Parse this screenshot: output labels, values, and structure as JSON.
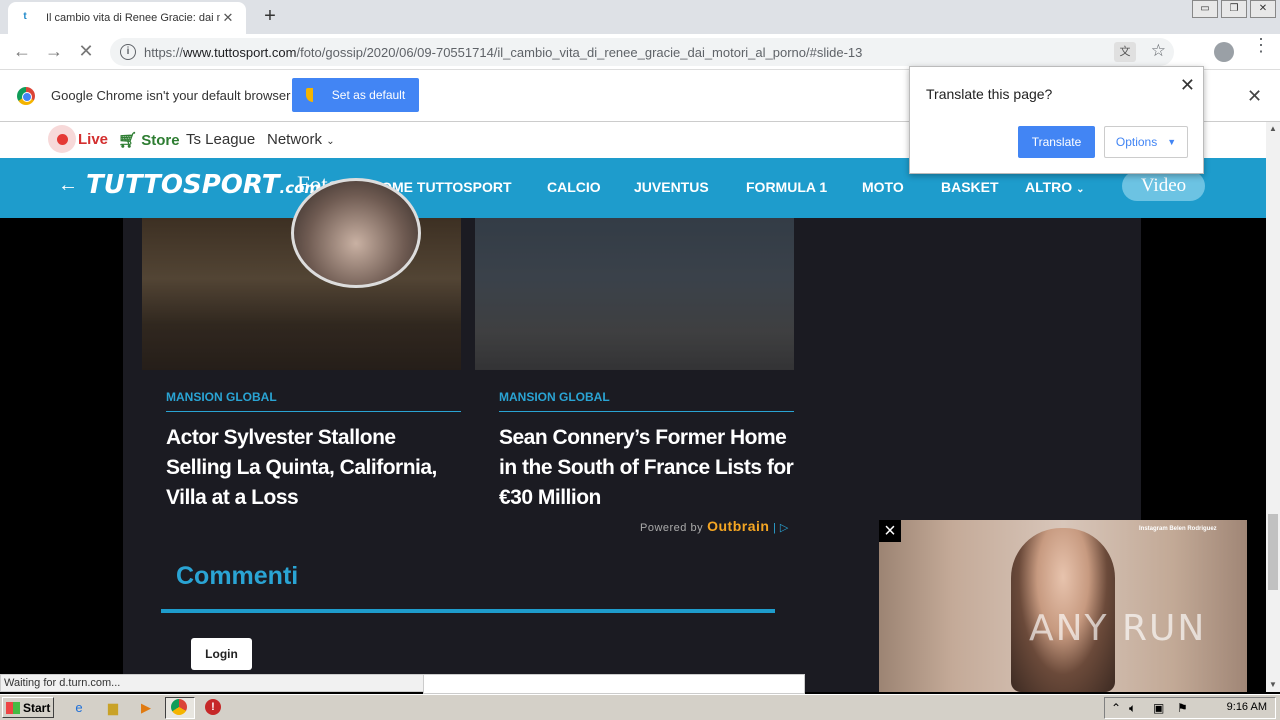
{
  "browser": {
    "tab_title": "Il cambio vita di Renee Gracie: dai m",
    "tab_close": "✕",
    "new_tab": "+",
    "url_prefix": "https://",
    "url_domain": "www.tuttosport.com",
    "url_path": "/foto/gossip/2020/06/09-70551714/il_cambio_vita_di_renee_gracie_dai_motori_al_porno/#slide-13",
    "window_controls": [
      "▭",
      "❐",
      "✕"
    ]
  },
  "infobar": {
    "message": "Google Chrome isn't your default browser",
    "button": "Set as default",
    "close": "✕"
  },
  "translate_popup": {
    "question": "Translate this page?",
    "translate_button": "Translate",
    "options_button": "Options",
    "close": "✕"
  },
  "site_top": {
    "live": "Live",
    "store": "Store",
    "league": "Ts League",
    "network": "Network"
  },
  "site_nav": {
    "brand": "TUTTOSPORT",
    "brand_suffix": ".com",
    "section": "Foto",
    "items": [
      "HOME TUTTOSPORT",
      "CALCIO",
      "JUVENTUS",
      "FORMULA 1",
      "MOTO",
      "BASKET",
      "ALTRO"
    ],
    "video": "Video"
  },
  "cards": [
    {
      "source": "MANSION GLOBAL",
      "headline": "Actor Sylvester Stallone Selling La Quinta, California, Villa at a Loss"
    },
    {
      "source": "MANSION GLOBAL",
      "headline": "Sean Connery’s Former Home in the South of France Lists for €30 Million"
    }
  ],
  "powered_by": "Powered by",
  "powered_brand": "Outbrain",
  "comments": {
    "title": "Commenti",
    "login": "Login"
  },
  "video_overlay": {
    "caption": "Instagram Belen Rodriguez",
    "watermark": "ANY RUN"
  },
  "status_text": "Waiting for d.turn.com...",
  "taskbar": {
    "start": "Start",
    "clock": "9:16 AM"
  }
}
